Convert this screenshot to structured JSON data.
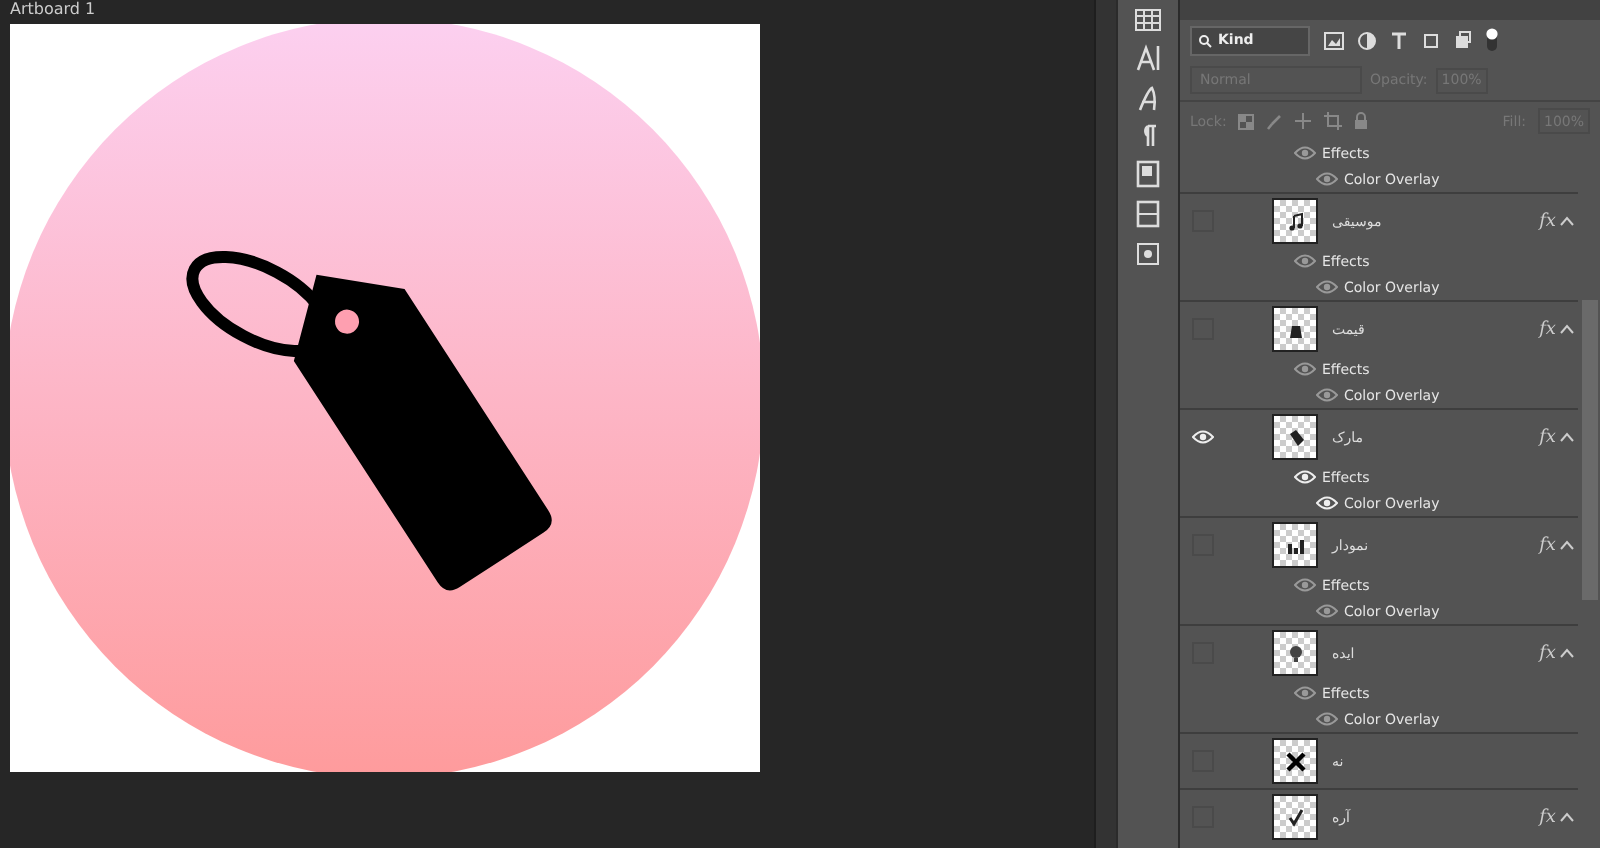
{
  "artboard": {
    "title": "Artboard 1"
  },
  "layers_panel": {
    "filter": {
      "label": "Kind"
    },
    "blend_mode": "Normal",
    "opacity_label": "Opacity:",
    "opacity": "100%",
    "lock_label": "Lock:",
    "fill_label": "Fill:",
    "fill": "100%",
    "layers": [
      {
        "kind": "effects",
        "label": "Effects",
        "items": [
          "Color Overlay"
        ]
      },
      {
        "kind": "layer",
        "name": "موسیقی",
        "visible": false,
        "fx": "fx",
        "effects": {
          "label": "Effects",
          "items": [
            "Color Overlay"
          ]
        }
      },
      {
        "kind": "layer",
        "name": "قیمت",
        "visible": false,
        "fx": "fx",
        "effects": {
          "label": "Effects",
          "items": [
            "Color Overlay"
          ]
        }
      },
      {
        "kind": "layer",
        "name": "مارک",
        "visible": true,
        "fx": "fx",
        "effects": {
          "label": "Effects",
          "items": [
            "Color Overlay"
          ]
        }
      },
      {
        "kind": "layer",
        "name": "نمودار",
        "visible": false,
        "fx": "fx",
        "effects": {
          "label": "Effects",
          "items": [
            "Color Overlay"
          ]
        }
      },
      {
        "kind": "layer",
        "name": "ایده",
        "visible": false,
        "fx": "fx",
        "effects": {
          "label": "Effects",
          "items": [
            "Color Overlay"
          ]
        }
      },
      {
        "kind": "layer",
        "name": "نه",
        "visible": false
      },
      {
        "kind": "layer",
        "name": "آره",
        "visible": false,
        "fx": "fx"
      }
    ]
  }
}
